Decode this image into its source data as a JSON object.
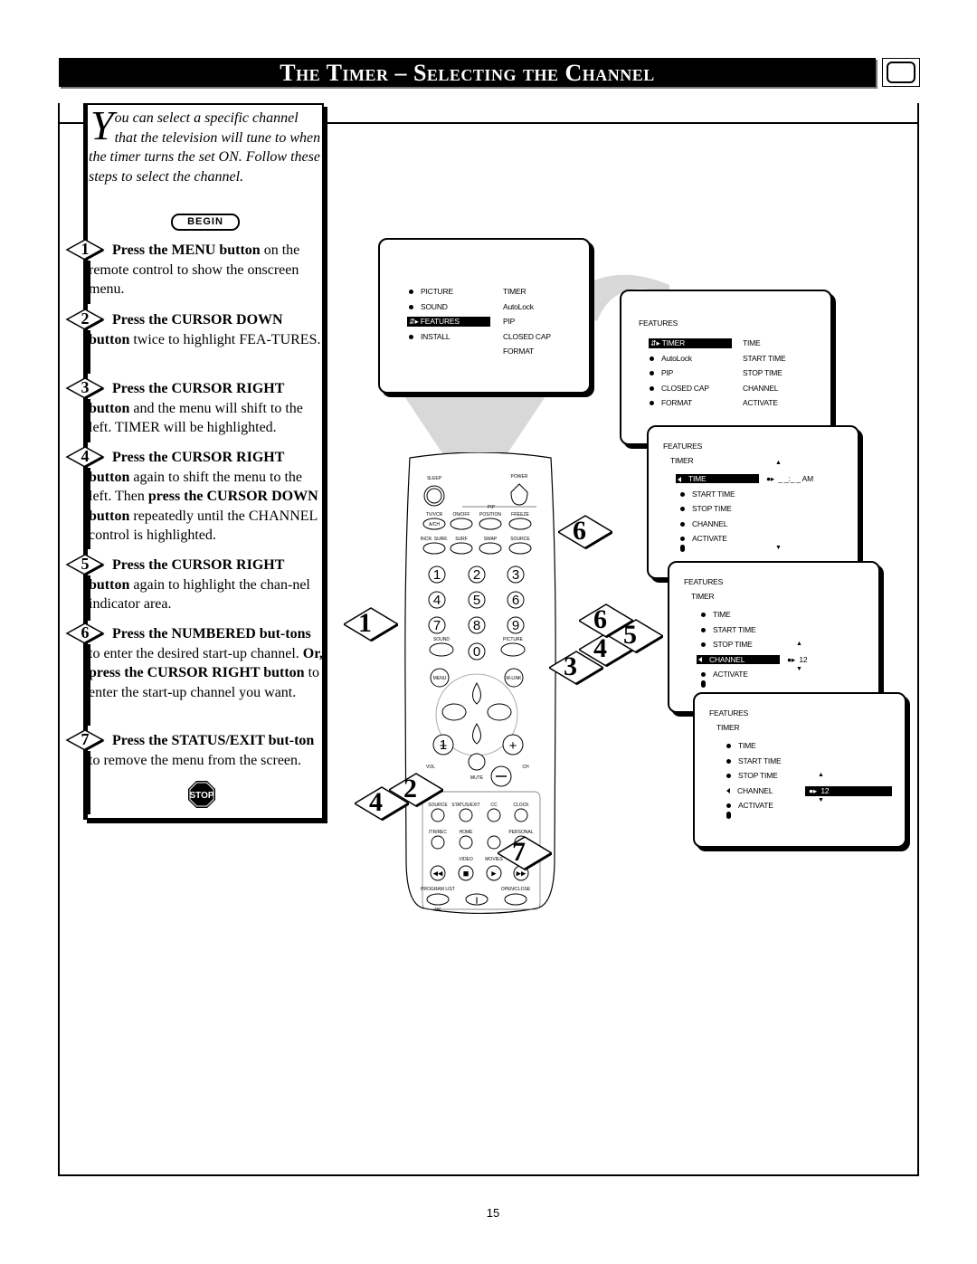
{
  "title": "The Timer – Selecting the Channel",
  "intro": {
    "dropcap": "Y",
    "text": "ou can select a specific channel that the television will tune to when the timer turns the set ON. Follow these steps to select the channel."
  },
  "begin_label": "BEGIN",
  "stop_label": "STOP",
  "steps": [
    {
      "num": "1",
      "bold": "Press the MENU button",
      "rest": " on the remote control to show the onscreen menu."
    },
    {
      "num": "2",
      "bold": "Press the CURSOR DOWN button",
      "rest": " twice to highlight FEA-TURES."
    },
    {
      "num": "3",
      "bold": "Press the CURSOR RIGHT button",
      "rest": " and the menu will shift to the left. TIMER will be highlighted."
    },
    {
      "num": "4",
      "bold": "Press the CURSOR RIGHT button",
      "rest": " again to shift the menu to the left. Then ",
      "bold2": "press the CURSOR DOWN button",
      "rest2": " repeatedly until the CHANNEL control is highlighted."
    },
    {
      "num": "5",
      "bold": "Press the CURSOR RIGHT button",
      "rest": " again to highlight the chan-nel indicator area."
    },
    {
      "num": "6",
      "bold": "Press the NUMBERED but-tons",
      "rest": " to enter the desired start-up channel.   ",
      "bold2": "Or, press the CURSOR RIGHT button",
      "rest2": " to enter the start-up channel you want."
    },
    {
      "num": "7",
      "bold": "Press the STATUS/EXIT but-ton",
      "rest": " to remove the menu from the screen."
    }
  ],
  "screens": {
    "main_menu": {
      "left": [
        "PICTURE",
        "SOUND",
        "FEATURES",
        "INSTALL"
      ],
      "selected": "FEATURES",
      "right": [
        "TIMER",
        "AutoLock",
        "PIP",
        "CLOSED CAP",
        "FORMAT"
      ]
    },
    "features_menu": {
      "header": "FEATURES",
      "left": [
        "TIMER",
        "AutoLock",
        "PIP",
        "CLOSED CAP",
        "FORMAT"
      ],
      "selected": "TIMER",
      "right": [
        "TIME",
        "START TIME",
        "STOP TIME",
        "CHANNEL",
        "ACTIVATE"
      ]
    },
    "timer_menu_time": {
      "header": "FEATURES",
      "sub": "TIMER",
      "items": [
        "TIME",
        "START TIME",
        "STOP TIME",
        "CHANNEL",
        "ACTIVATE"
      ],
      "selected": "TIME",
      "value": "_ _:_ _  AM"
    },
    "timer_menu_channel": {
      "header": "FEATURES",
      "sub": "TIMER",
      "items": [
        "TIME",
        "START TIME",
        "STOP TIME",
        "CHANNEL",
        "ACTIVATE"
      ],
      "selected": "CHANNEL",
      "value": "12"
    },
    "timer_menu_channel_value": {
      "header": "FEATURES",
      "sub": "TIMER",
      "items": [
        "TIME",
        "START TIME",
        "STOP TIME",
        "CHANNEL",
        "ACTIVATE"
      ],
      "selected": "CHANNEL",
      "value": "12"
    }
  },
  "remote": {
    "labels": {
      "sleep": "SLEEP",
      "power": "POWER",
      "pip": "PIP",
      "tvvcr": "TV/VCR",
      "ach": "A/CH",
      "onoff": "ON/OFF",
      "position": "POSITION",
      "freeze": "FREEZE",
      "incr_surr": "INCR. SURR.",
      "surf": "SURF",
      "swap": "SWAP",
      "source": "SOURCE",
      "sound": "SOUND",
      "picture": "PICTURE",
      "menu": "MENU",
      "mlink": "M-LINK",
      "vol": "VOL",
      "ch": "CH",
      "mute": "MUTE",
      "source2": "SOURCE",
      "status_exit": "STATUS/EXIT",
      "cc": "CC",
      "clock": "CLOCK",
      "itr_rec": "ITR/REC",
      "home": "HOME",
      "personal": "PERSONAL",
      "video": "VIDEO",
      "movies": "MOVIES",
      "program_list": "PROGRAM LIST",
      "open_close": "OPEN/CLOSE",
      "ok": "OK"
    },
    "digits": [
      "1",
      "2",
      "3",
      "4",
      "5",
      "6",
      "7",
      "8",
      "9",
      "0"
    ]
  },
  "callouts": [
    "1",
    "2",
    "3",
    "4",
    "5",
    "6",
    "6",
    "7",
    "4"
  ],
  "page_number": "15"
}
